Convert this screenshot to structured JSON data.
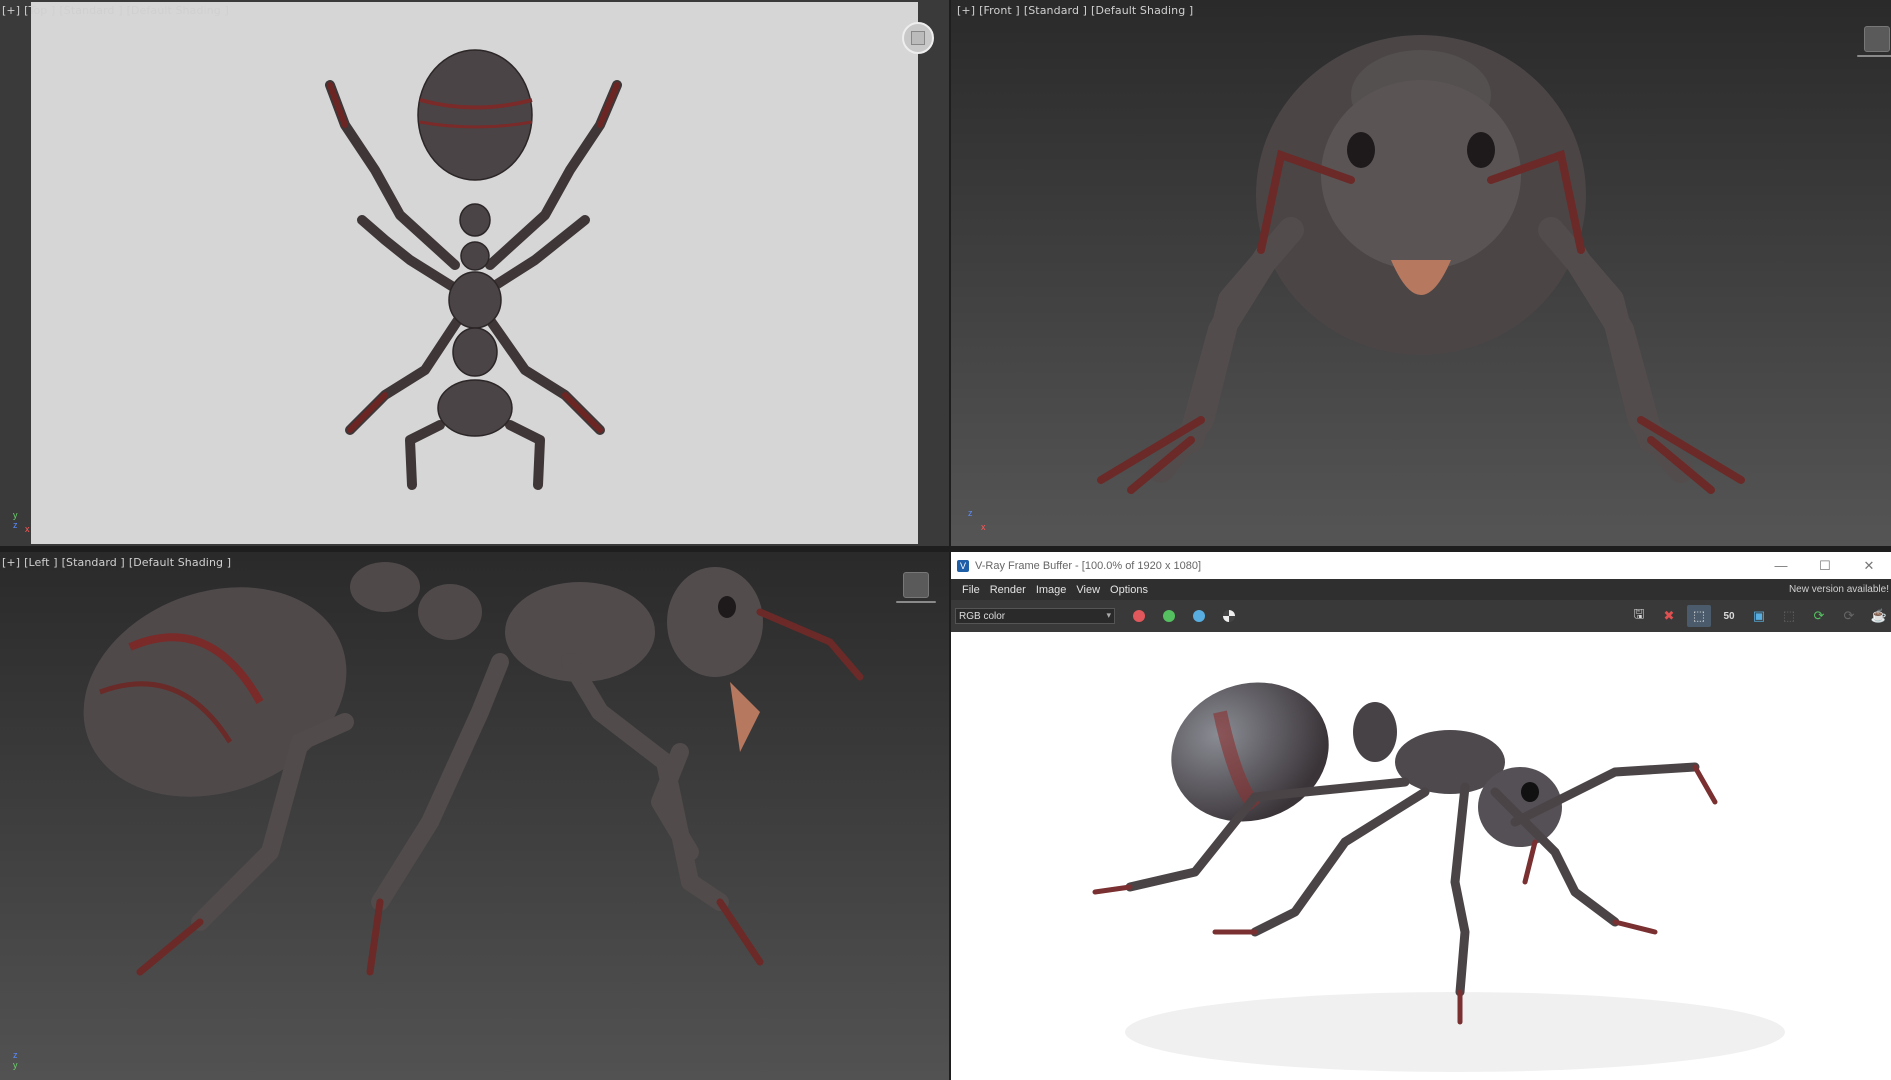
{
  "viewports": {
    "top": {
      "labels": [
        "[+]",
        "[Top ]",
        "[Standard ]",
        "[Default Shading ]"
      ]
    },
    "front": {
      "labels": [
        "[+]",
        "[Front ]",
        "[Standard ]",
        "[Default Shading ]"
      ]
    },
    "left": {
      "labels": [
        "[+]",
        "[Left ]",
        "[Standard ]",
        "[Default Shading ]"
      ]
    }
  },
  "vfb": {
    "title": "V-Ray Frame Buffer - [100.0% of 1920 x 1080]",
    "menu": [
      "File",
      "Render",
      "Image",
      "View",
      "Options"
    ],
    "notice": "New version available!",
    "channel": "RGB color",
    "channel_dots": {
      "red": "#e0585c",
      "green": "#55c060",
      "blue": "#58aee0"
    },
    "icons": [
      "save-icon",
      "clear-image-icon",
      "track-mouse-icon",
      "lens-effects-icon",
      "region-render-icon",
      "stop-render-icon",
      "render-icon",
      "teapot-icon"
    ],
    "toolbar_text": "50"
  },
  "colors": {
    "top_viewport_bg": "#d6d6d6",
    "ant_body": "#4d4749",
    "ant_red": "#7a2a28"
  }
}
